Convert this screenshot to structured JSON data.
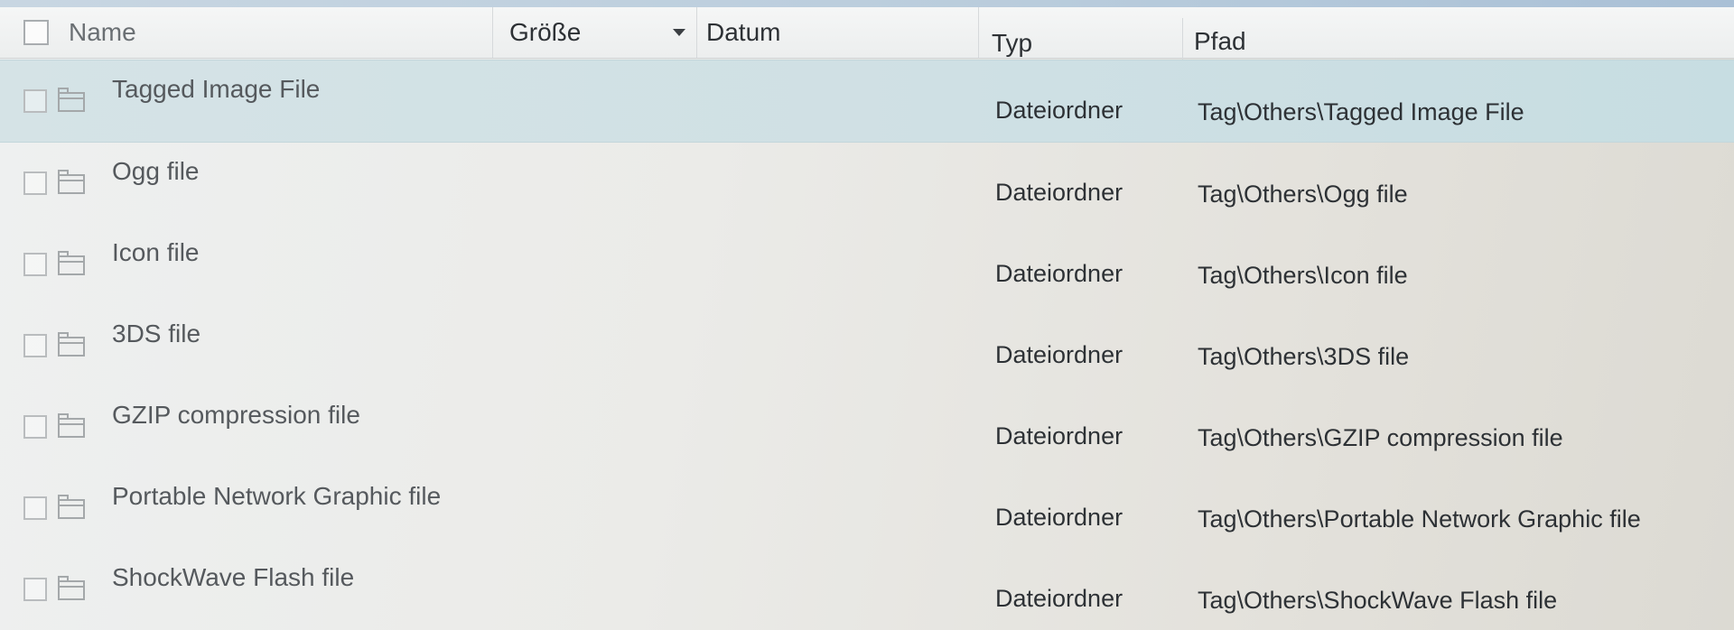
{
  "columns": {
    "name": "Name",
    "size": "Größe",
    "date": "Datum",
    "type": "Typ",
    "path": "Pfad"
  },
  "sort": {
    "column": "size",
    "direction": "descending",
    "icon": "sort-down-arrow-icon"
  },
  "rows": [
    {
      "name": "Tagged Image File",
      "type": "Dateiordner",
      "path": "Tag\\Others\\Tagged Image File",
      "selected": true,
      "icon": "folder-icon"
    },
    {
      "name": "Ogg file",
      "type": "Dateiordner",
      "path": "Tag\\Others\\Ogg file",
      "selected": false,
      "icon": "folder-icon"
    },
    {
      "name": "Icon file",
      "type": "Dateiordner",
      "path": "Tag\\Others\\Icon file",
      "selected": false,
      "icon": "folder-icon"
    },
    {
      "name": "3DS file",
      "type": "Dateiordner",
      "path": "Tag\\Others\\3DS file",
      "selected": false,
      "icon": "folder-icon"
    },
    {
      "name": "GZIP compression file",
      "type": "Dateiordner",
      "path": "Tag\\Others\\GZIP compression file",
      "selected": false,
      "icon": "folder-icon"
    },
    {
      "name": "Portable Network Graphic file",
      "type": "Dateiordner",
      "path": "Tag\\Others\\Portable Network Graphic file",
      "selected": false,
      "icon": "folder-icon"
    },
    {
      "name": "ShockWave Flash file",
      "type": "Dateiordner",
      "path": "Tag\\Others\\ShockWave Flash file",
      "selected": false,
      "icon": "folder-icon"
    }
  ],
  "colors": {
    "selected_row": "#cfe0e4",
    "header_bg": "#eceeee",
    "text": "#2d3135",
    "muted_text": "#55595d"
  }
}
